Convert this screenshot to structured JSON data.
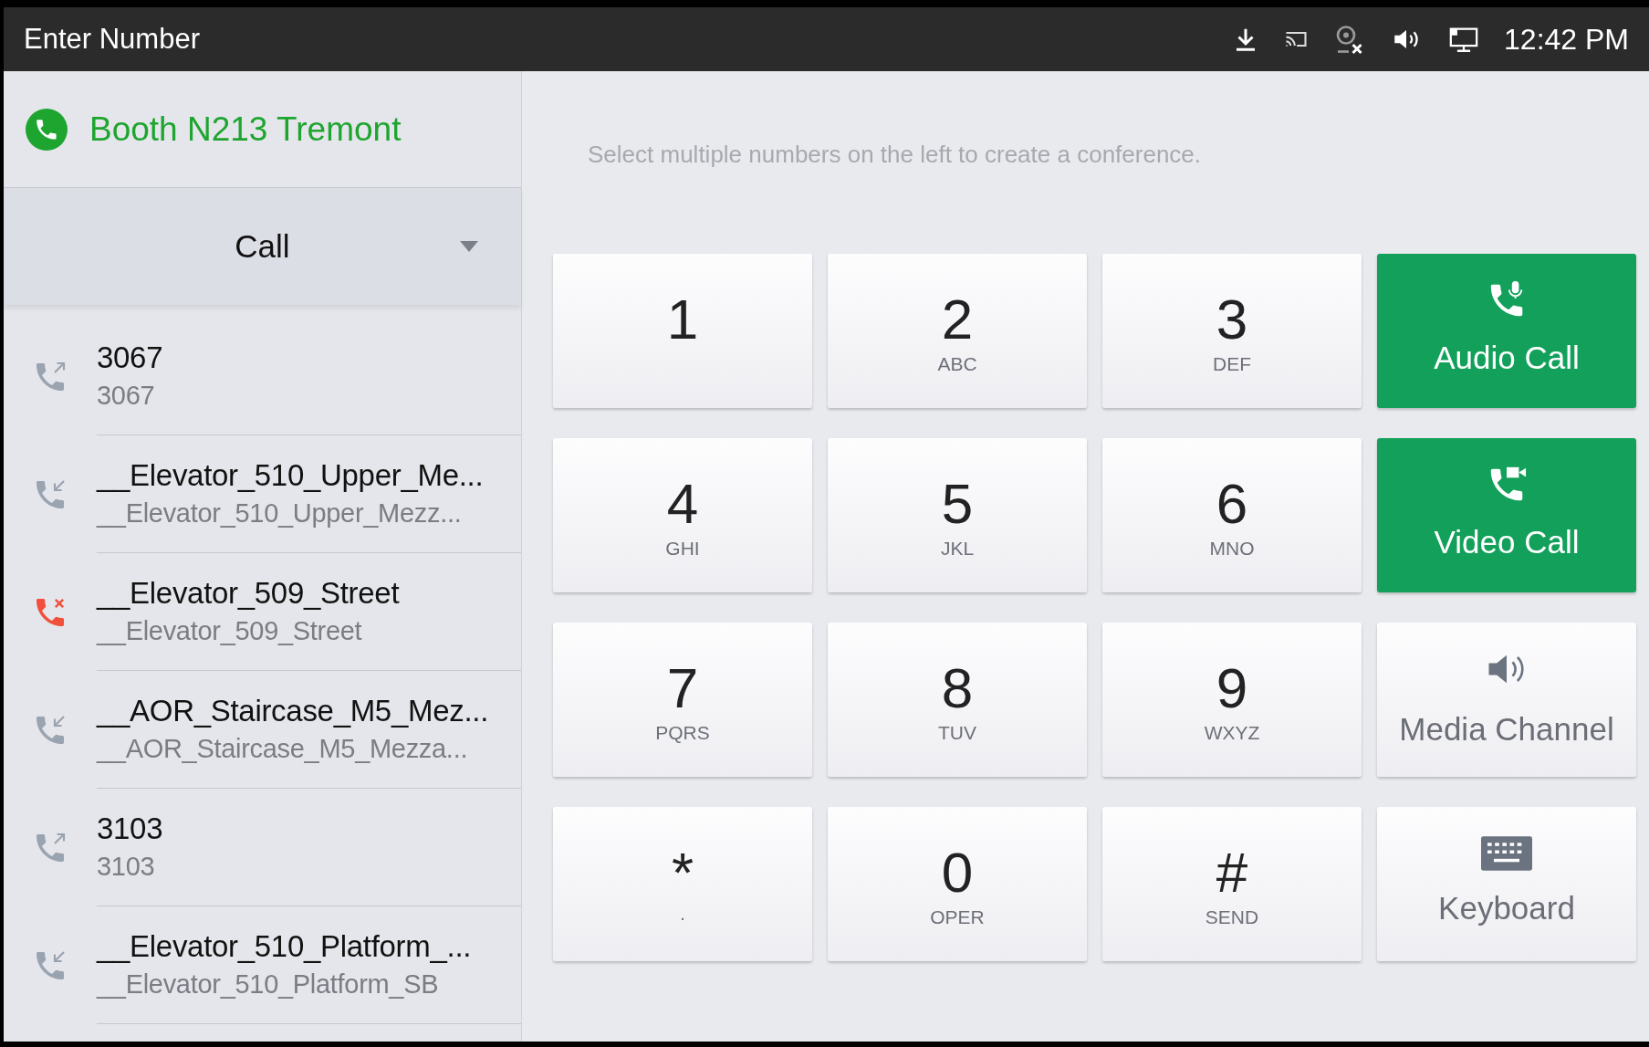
{
  "status_bar": {
    "title": "Enter Number",
    "time": "12:42 PM"
  },
  "account": {
    "name": "Booth N213 Tremont"
  },
  "call_mode": {
    "label": "Call"
  },
  "history": [
    {
      "name": "3067",
      "number": "3067",
      "kind": "outgoing"
    },
    {
      "name": "__Elevator_510_Upper_Me...",
      "number": "__Elevator_510_Upper_Mezz...",
      "kind": "incoming"
    },
    {
      "name": "__Elevator_509_Street",
      "number": "__Elevator_509_Street",
      "kind": "missed"
    },
    {
      "name": "__AOR_Staircase_M5_Mez...",
      "number": "__AOR_Staircase_M5_Mezza...",
      "kind": "incoming"
    },
    {
      "name": "3103",
      "number": "3103",
      "kind": "outgoing"
    },
    {
      "name": "__Elevator_510_Platform_...",
      "number": "__Elevator_510_Platform_SB",
      "kind": "incoming"
    }
  ],
  "hint": "Select multiple numbers on the left to create a conference.",
  "keypad": [
    {
      "digit": "1"
    },
    {
      "digit": "2",
      "letters": "ABC"
    },
    {
      "digit": "3",
      "letters": "DEF"
    },
    {
      "digit": "4",
      "letters": "GHI"
    },
    {
      "digit": "5",
      "letters": "JKL"
    },
    {
      "digit": "6",
      "letters": "MNO"
    },
    {
      "digit": "7",
      "letters": "PQRS"
    },
    {
      "digit": "8",
      "letters": "TUV"
    },
    {
      "digit": "9",
      "letters": "WXYZ"
    },
    {
      "digit": "*",
      "letters": "·"
    },
    {
      "digit": "0",
      "letters": "OPER"
    },
    {
      "digit": "#",
      "letters": "SEND"
    }
  ],
  "actions": [
    {
      "label": "Audio Call",
      "kind": "audio",
      "primary": true
    },
    {
      "label": "Video Call",
      "kind": "video",
      "primary": true
    },
    {
      "label": "Media Channel",
      "kind": "media",
      "primary": false
    },
    {
      "label": "Keyboard",
      "kind": "keyboard",
      "primary": false
    }
  ]
}
